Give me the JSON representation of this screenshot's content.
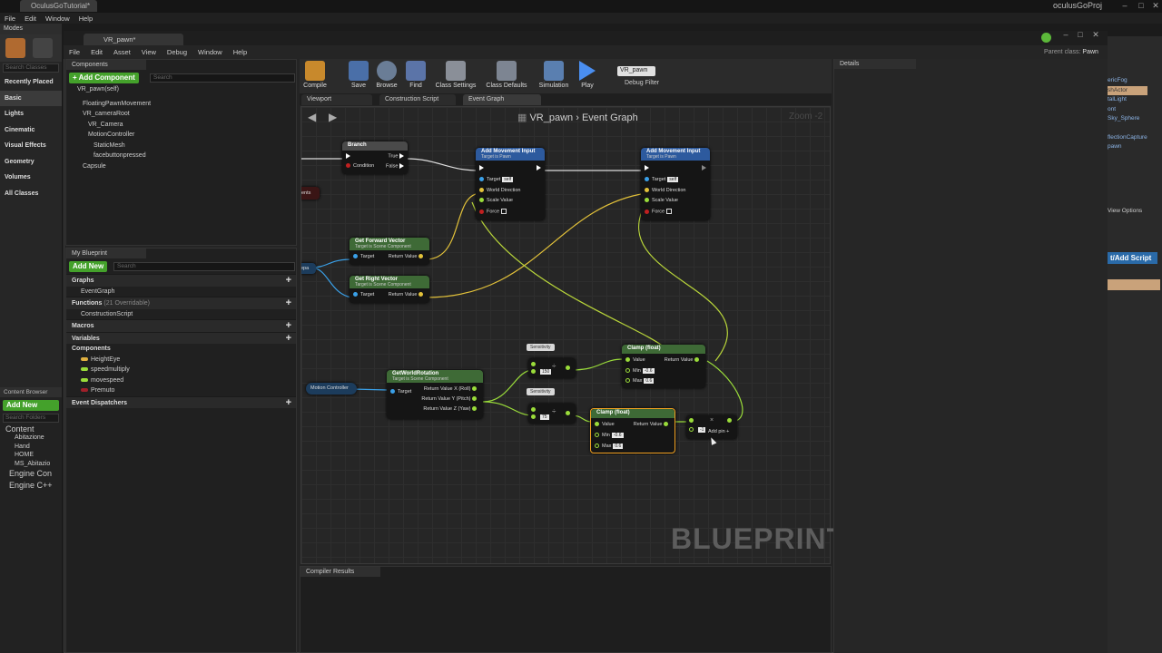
{
  "top": {
    "tab": "OculusGoTutorial*",
    "menu": [
      "File",
      "Edit",
      "Window",
      "Help"
    ],
    "project": "oculusGoProj"
  },
  "modes": {
    "title": "Modes",
    "search": "Search Classes",
    "categories": [
      "Recently Placed",
      "Basic",
      "Lights",
      "Cinematic",
      "Visual Effects",
      "Geometry",
      "Volumes",
      "All Classes"
    ]
  },
  "content_browser": {
    "title": "Content Browser",
    "add_new": "Add New",
    "search": "Search Folders",
    "tree": [
      "Content",
      "Abitazione",
      "Hand",
      "HOME",
      "MS_Abitazio",
      "Engine Con",
      "Engine C++"
    ]
  },
  "bp": {
    "tab": "VR_pawn*",
    "menu": [
      "File",
      "Edit",
      "Asset",
      "View",
      "Debug",
      "Window",
      "Help"
    ],
    "parent_label": "Parent class:",
    "parent_value": "Pawn"
  },
  "components": {
    "title": "Components",
    "add": "+ Add Component",
    "search": "Search",
    "self": "VR_pawn(self)",
    "items": [
      "FloatingPawnMovement",
      "VR_cameraRoot",
      "VR_Camera",
      "MotionController",
      "StaticMesh",
      "facebuttonpressed",
      "Capsule"
    ]
  },
  "mybp": {
    "title": "My Blueprint",
    "add": "Add New",
    "search": "Search",
    "graphs": "Graphs",
    "event_graph": "EventGraph",
    "functions": "Functions",
    "functions_note": "(21 Overridable)",
    "construction": "ConstructionScript",
    "macros": "Macros",
    "variables": "Variables",
    "components": "Components",
    "vars": [
      "HeightEye",
      "speedmultiply",
      "movespeed",
      "Premuto"
    ],
    "dispatchers": "Event Dispatchers"
  },
  "toolbar": {
    "buttons": [
      "Compile",
      "Save",
      "Browse",
      "Find",
      "Class Settings",
      "Class Defaults",
      "Simulation",
      "Play"
    ],
    "debug_sel": "VR_pawn",
    "debug_label": "Debug Filter"
  },
  "graph_tabs": [
    "Viewport",
    "Construction Script",
    "Event Graph"
  ],
  "graph": {
    "crumb_bp": "VR_pawn",
    "crumb_graph": "Event Graph",
    "zoom": "Zoom -2",
    "watermark": "BLUEPRINT"
  },
  "nodes": {
    "branch": {
      "title": "Branch",
      "condition": "Condition",
      "true": "True",
      "false": "False"
    },
    "add_move1": {
      "title": "Add Movement Input",
      "sub": "Target is Pawn",
      "target": "Target",
      "self": "self",
      "world": "World Direction",
      "scale": "Scale Value",
      "force": "Force"
    },
    "add_move2": {
      "title": "Add Movement Input",
      "sub": "Target is Pawn",
      "target": "Target",
      "self": "self",
      "world": "World Direction",
      "scale": "Scale Value",
      "force": "Force"
    },
    "fwd": {
      "title": "Get Forward Vector",
      "sub": "Target is Scene Component",
      "target": "Target",
      "ret": "Return Value"
    },
    "right": {
      "title": "Get Right Vector",
      "sub": "Target is Scene Component",
      "target": "Target",
      "ret": "Return Value"
    },
    "rot": {
      "title": "GetWorldRotation",
      "sub": "Target is Scene Component",
      "target": "Target",
      "x": "Return Value X (Roll)",
      "y": "Return Value Y (Pitch)",
      "z": "Return Value Z (Yaw)"
    },
    "mc": "Motion Controller",
    "sens1": "Sensitivity",
    "sens2": "Sensitivity",
    "div1": "150",
    "div2": "75",
    "clamp1": {
      "title": "Clamp (float)",
      "value": "Value",
      "min": "Min",
      "minv": "-0.6",
      "max": "Max",
      "maxv": "0.6",
      "ret": "Return Value"
    },
    "clamp2": {
      "title": "Clamp (float)",
      "value": "Value",
      "min": "Min",
      "minv": "-0.6",
      "max": "Max",
      "maxv": "0.6",
      "ret": "Return Value"
    },
    "mult": {
      "v": "-1",
      "addpin": "Add pin"
    },
    "left_frag": "ents",
    "left_frag2": "ера"
  },
  "details": "Details",
  "compiler": "Compiler Results",
  "right": {
    "items": [
      "ericFog",
      "shActor",
      "talLight",
      "ont",
      "Sky_Sphere",
      "flectionCapture",
      "pawn"
    ],
    "view_options": "View Options",
    "add_script": "t/Add Script"
  }
}
